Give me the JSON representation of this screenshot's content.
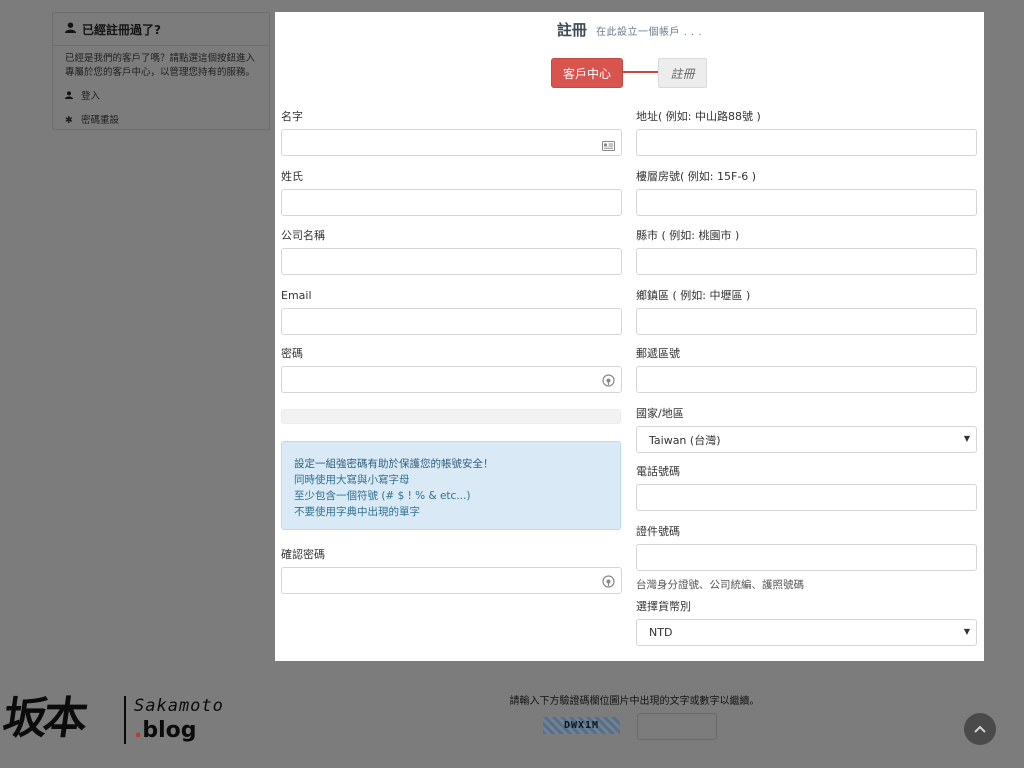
{
  "background": {
    "panel": {
      "title": "已經註冊過了?",
      "text": "已經是我們的客戶了嗎？請點選這個按鈕進入專屬於您的客戶中心，以管理您持有的服務。",
      "links": [
        "登入",
        "密碼重設"
      ]
    },
    "captcha": {
      "instruction": "請輸入下方驗證碼欄位圖片中出現的文字或數字以繼續。",
      "code": "DWX1M"
    },
    "logo": {
      "kanji": "坂本",
      "name": "Sakamoto",
      "blog_dot": ".",
      "blog": "blog"
    }
  },
  "modal": {
    "title": "註冊",
    "subtitle": "在此設立一個帳戶 . . .",
    "steps": [
      "客戶中心",
      "註冊"
    ]
  },
  "form": {
    "left": {
      "first_name": {
        "label": "名字",
        "value": ""
      },
      "last_name": {
        "label": "姓氏",
        "value": ""
      },
      "company": {
        "label": "公司名稱",
        "value": ""
      },
      "email": {
        "label": "Email",
        "value": ""
      },
      "password": {
        "label": "密碼",
        "value": ""
      },
      "confirm_password": {
        "label": "確認密碼",
        "value": ""
      },
      "tips": {
        "heading": "設定一組強密碼有助於保護您的帳號安全！",
        "lines": [
          "同時使用大寫與小寫字母",
          "至少包含一個符號 (# $ ! % & etc...)",
          "不要使用字典中出現的單字"
        ]
      }
    },
    "right": {
      "address1": {
        "label": "地址( 例如: 中山路88號 )",
        "value": ""
      },
      "address2": {
        "label": "樓層房號( 例如: 15F-6 )",
        "value": ""
      },
      "city": {
        "label": "縣市 ( 例如: 桃園市 )",
        "value": ""
      },
      "state": {
        "label": "鄉鎮區 ( 例如: 中壢區 )",
        "value": ""
      },
      "postcode": {
        "label": "郵遞區號",
        "value": ""
      },
      "country": {
        "label": "國家/地區",
        "value": "Taiwan (台灣)"
      },
      "phone": {
        "label": "電話號碼",
        "value": ""
      },
      "id_number": {
        "label": "證件號碼",
        "value": "",
        "help": "台灣身分證號、公司統編、護照號碼"
      },
      "currency": {
        "label": "選擇貨幣別",
        "value": "NTD"
      }
    }
  },
  "colors": {
    "accent_red": "#d9534f",
    "tip_bg": "#d9eaf6",
    "tip_text": "#31708f",
    "overlay": "#7c7c7c"
  }
}
